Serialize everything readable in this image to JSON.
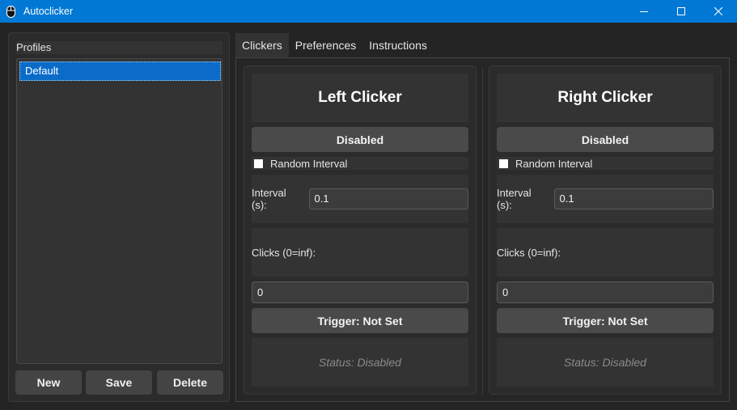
{
  "window": {
    "title": "Autoclicker",
    "app_icon": "mouse-icon",
    "controls": [
      "minimize-icon",
      "maximize-icon",
      "close-icon"
    ],
    "accent_color": "#0078d4"
  },
  "profiles": {
    "label": "Profiles",
    "items": [
      "Default"
    ],
    "selected": "Default",
    "buttons": {
      "new": "New",
      "save": "Save",
      "delete": "Delete"
    }
  },
  "tabs": [
    {
      "label": "Clickers",
      "active": true
    },
    {
      "label": "Preferences",
      "active": false
    },
    {
      "label": "Instructions",
      "active": false
    }
  ],
  "clickers": {
    "left": {
      "title": "Left Clicker",
      "state": "Disabled",
      "random_interval_label": "Random Interval",
      "random_interval_checked": false,
      "interval_label": "Interval (s):",
      "interval_value": "0.1",
      "clicks_label": "Clicks (0=inf):",
      "clicks_value": "0",
      "trigger": "Trigger: Not Set",
      "status": "Status: Disabled"
    },
    "right": {
      "title": "Right Clicker",
      "state": "Disabled",
      "random_interval_label": "Random Interval",
      "random_interval_checked": false,
      "interval_label": "Interval (s):",
      "interval_value": "0.1",
      "clicks_label": "Clicks (0=inf):",
      "clicks_value": "0",
      "trigger": "Trigger: Not Set",
      "status": "Status: Disabled"
    }
  }
}
